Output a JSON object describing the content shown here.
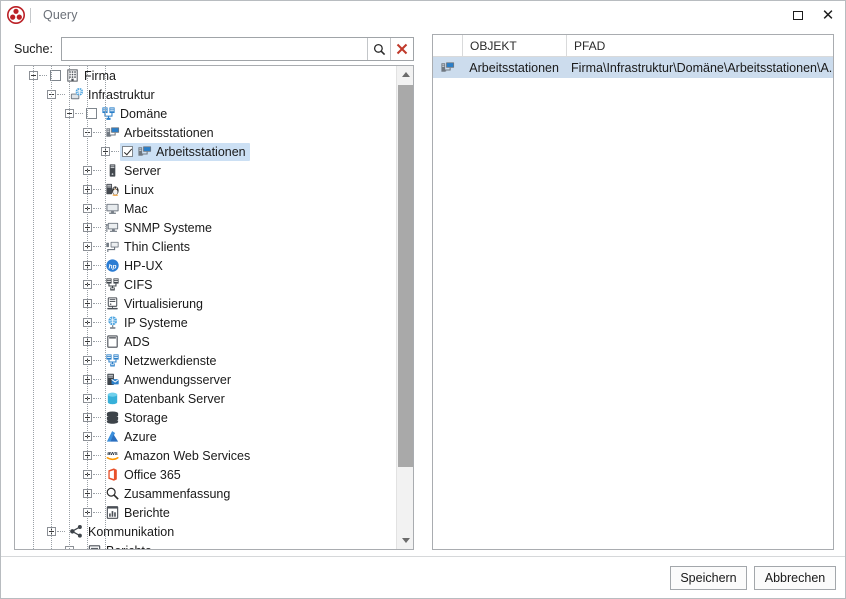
{
  "window": {
    "title": "Query",
    "logo_icon": "app-logo-red-circle",
    "controls": [
      {
        "name": "maximize-button",
        "icon": "maximize-icon"
      },
      {
        "name": "close-button",
        "icon": "close-icon"
      }
    ]
  },
  "search": {
    "label": "Suche:",
    "value": "",
    "placeholder": "",
    "search_icon": "magnifier-icon",
    "clear_icon": "red-x-icon"
  },
  "tree": {
    "items": [
      {
        "label": "Firma",
        "depth": 0,
        "expander": "minus",
        "checkbox": "unchecked",
        "icon": "building-icon",
        "selected": false
      },
      {
        "label": "Infrastruktur",
        "depth": 1,
        "expander": "minus",
        "checkbox": "none",
        "icon": "globe-monitor-icon",
        "selected": false
      },
      {
        "label": "Domäne",
        "depth": 2,
        "expander": "minus",
        "checkbox": "unchecked",
        "icon": "domain-servers-icon",
        "selected": false
      },
      {
        "label": "Arbeitsstationen",
        "depth": 3,
        "expander": "minus",
        "checkbox": "none",
        "icon": "workstation-icon",
        "selected": false
      },
      {
        "label": "Arbeitsstationen",
        "depth": 4,
        "expander": "plus",
        "checkbox": "checked",
        "icon": "workstation-icon",
        "selected": true
      },
      {
        "label": "Server",
        "depth": 3,
        "expander": "plus",
        "checkbox": "none",
        "icon": "server-tower-icon",
        "selected": false
      },
      {
        "label": "Linux",
        "depth": 3,
        "expander": "plus",
        "checkbox": "none",
        "icon": "linux-penguin-icon",
        "selected": false
      },
      {
        "label": "Mac",
        "depth": 3,
        "expander": "plus",
        "checkbox": "none",
        "icon": "imac-monitor-icon",
        "selected": false
      },
      {
        "label": "SNMP Systeme",
        "depth": 3,
        "expander": "plus",
        "checkbox": "none",
        "icon": "snmp-monitor-icon",
        "selected": false
      },
      {
        "label": "Thin Clients",
        "depth": 3,
        "expander": "plus",
        "checkbox": "none",
        "icon": "thin-client-icon",
        "selected": false
      },
      {
        "label": "HP-UX",
        "depth": 3,
        "expander": "plus",
        "checkbox": "none",
        "icon": "hp-logo-icon",
        "selected": false
      },
      {
        "label": "CIFS",
        "depth": 3,
        "expander": "plus",
        "checkbox": "none",
        "icon": "cifs-servers-icon",
        "selected": false
      },
      {
        "label": "Virtualisierung",
        "depth": 3,
        "expander": "plus",
        "checkbox": "none",
        "icon": "virtualization-icon",
        "selected": false
      },
      {
        "label": "IP Systeme",
        "depth": 3,
        "expander": "plus",
        "checkbox": "none",
        "icon": "ip-globe-icon",
        "selected": false
      },
      {
        "label": "ADS",
        "depth": 3,
        "expander": "plus",
        "checkbox": "none",
        "icon": "ads-window-icon",
        "selected": false
      },
      {
        "label": "Netzwerkdienste",
        "depth": 3,
        "expander": "plus",
        "checkbox": "none",
        "icon": "network-services-icon",
        "selected": false
      },
      {
        "label": "Anwendungsserver",
        "depth": 3,
        "expander": "plus",
        "checkbox": "none",
        "icon": "app-server-icon",
        "selected": false
      },
      {
        "label": "Datenbank Server",
        "depth": 3,
        "expander": "plus",
        "checkbox": "none",
        "icon": "database-icon",
        "selected": false
      },
      {
        "label": "Storage",
        "depth": 3,
        "expander": "plus",
        "checkbox": "none",
        "icon": "storage-disks-icon",
        "selected": false
      },
      {
        "label": "Azure",
        "depth": 3,
        "expander": "plus",
        "checkbox": "none",
        "icon": "azure-logo-icon",
        "selected": false
      },
      {
        "label": "Amazon Web Services",
        "depth": 3,
        "expander": "plus",
        "checkbox": "none",
        "icon": "aws-logo-icon",
        "selected": false
      },
      {
        "label": "Office 365",
        "depth": 3,
        "expander": "plus",
        "checkbox": "none",
        "icon": "office365-logo-icon",
        "selected": false
      },
      {
        "label": "Zusammenfassung",
        "depth": 3,
        "expander": "plus",
        "checkbox": "none",
        "icon": "magnifier-icon",
        "selected": false
      },
      {
        "label": "Berichte",
        "depth": 3,
        "expander": "plus",
        "checkbox": "none",
        "icon": "report-chart-icon",
        "selected": false
      },
      {
        "label": "Kommunikation",
        "depth": 1,
        "expander": "plus",
        "checkbox": "none",
        "icon": "share-nodes-icon",
        "selected": false
      },
      {
        "label": "Berichte",
        "depth": 2,
        "expander": "plus",
        "checkbox": "none",
        "icon": "document-icon",
        "selected": false
      }
    ]
  },
  "list": {
    "columns": [
      "",
      "OBJEKT",
      "PFAD"
    ],
    "rows": [
      {
        "icon": "workstation-icon",
        "objekt": "Arbeitsstationen",
        "pfad": "Firma\\Infrastruktur\\Domäne\\Arbeitsstationen\\A...",
        "selected": true
      }
    ]
  },
  "footer": {
    "save_label": "Speichern",
    "cancel_label": "Abbrechen"
  },
  "colors": {
    "accent_blue": "#2a7fc9",
    "selection_blue": "#cce0f4",
    "list_selection": "#ccdced",
    "logo_red": "#c0232a",
    "clear_x_red": "#c0392b"
  }
}
